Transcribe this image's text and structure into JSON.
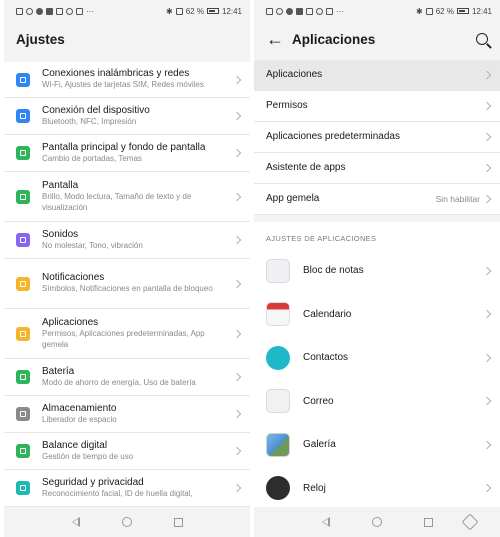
{
  "status_bar": {
    "battery": "62 %",
    "time": "12:41",
    "battery_percent": 62
  },
  "left": {
    "title": "Ajustes",
    "items": [
      {
        "title": "Conexiones inalámbricas y redes",
        "subtitle": "Wi-Fi, Ajustes de tarjetas SIM, Redes móviles",
        "icon": "wifi-icon",
        "color": "#2f86f6"
      },
      {
        "title": "Conexión del dispositivo",
        "subtitle": "Bluetooth, NFC, Impresión",
        "icon": "device-connection-icon",
        "color": "#2f86f6"
      },
      {
        "title": "Pantalla principal y fondo de pantalla",
        "subtitle": "Cambio de portadas, Temas",
        "icon": "wallpaper-icon",
        "color": "#2fb45a"
      },
      {
        "title": "Pantalla",
        "subtitle": "Brillo, Modo lectura, Tamaño de texto y de visualización",
        "icon": "display-icon",
        "color": "#2fb45a"
      },
      {
        "title": "Sonidos",
        "subtitle": "No molestar, Tono, vibración",
        "icon": "sound-icon",
        "color": "#8a63f2"
      },
      {
        "title": "Notificaciones",
        "subtitle": "Símbolos, Notificaciones en pantalla de bloqueo",
        "icon": "notification-bell-icon",
        "color": "#f5b52a"
      },
      {
        "title": "Aplicaciones",
        "subtitle": "Permisos, Aplicaciones predeterminadas, App gemela",
        "icon": "apps-grid-icon",
        "color": "#f5b52a"
      },
      {
        "title": "Batería",
        "subtitle": "Modo de ahorro de energía, Uso de batería",
        "icon": "battery-icon",
        "color": "#2fb45a"
      },
      {
        "title": "Almacenamiento",
        "subtitle": "Liberador de espacio",
        "icon": "storage-icon",
        "color": "#8a8a8a"
      },
      {
        "title": "Balance digital",
        "subtitle": "Gestión de tiempo de uso",
        "icon": "hourglass-icon",
        "color": "#2fb45a"
      },
      {
        "title": "Seguridad y privacidad",
        "subtitle": "Reconocimiento facial, ID de huella digital,",
        "icon": "shield-icon",
        "color": "#1fb8b0"
      }
    ]
  },
  "right": {
    "title": "Aplicaciones",
    "menu": [
      {
        "title": "Aplicaciones",
        "value": ""
      },
      {
        "title": "Permisos",
        "value": ""
      },
      {
        "title": "Aplicaciones predeterminadas",
        "value": ""
      },
      {
        "title": "Asistente de apps",
        "value": ""
      },
      {
        "title": "App gemela",
        "value": "Sin habilitar"
      }
    ],
    "section_label": "AJUSTES DE APLICACIONES",
    "apps": [
      {
        "name": "Bloc de notas",
        "icon": "notepad-icon"
      },
      {
        "name": "Calendario",
        "icon": "calendar-icon"
      },
      {
        "name": "Contactos",
        "icon": "contacts-icon"
      },
      {
        "name": "Correo",
        "icon": "mail-icon"
      },
      {
        "name": "Galería",
        "icon": "gallery-icon"
      },
      {
        "name": "Reloj",
        "icon": "clock-icon"
      }
    ]
  }
}
